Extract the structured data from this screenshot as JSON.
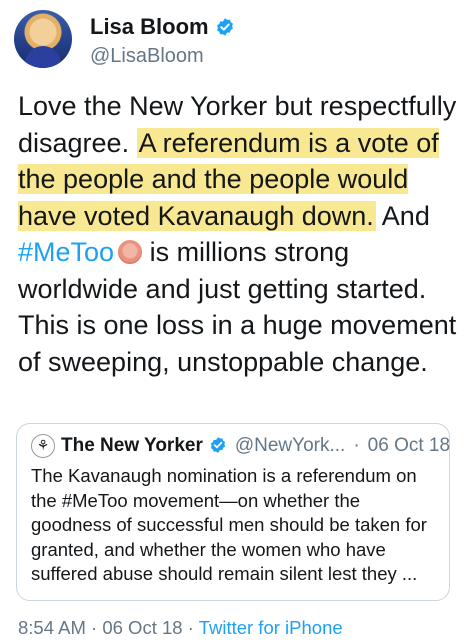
{
  "author": {
    "name": "Lisa Bloom",
    "handle": "@LisaBloom",
    "verified_icon": "verified-badge-icon",
    "accent": "#1da1f2"
  },
  "tweet": {
    "text_1": "Love the New Yorker but respectfully disagree. ",
    "highlight": "A referendum is a vote of the people and the people would have voted Kavanaugh down.",
    "text_2": " And ",
    "hashtag": "#MeToo",
    "emoji_icon": "raised-hands-icon",
    "text_3": " is millions strong worldwide and just getting started. This is one loss in a huge movement of sweeping, unstoppable change.",
    "highlight_color": "#f7e06e"
  },
  "quoted": {
    "name": "The New Yorker",
    "handle": "@NewYork...",
    "separator": "·",
    "date": "06 Oct 18",
    "text": "The Kavanaugh nomination is a referendum on the #MeToo movement—on whether the goodness of successful men should be taken for granted, and whether the women who have suffered abuse should remain silent lest they ..."
  },
  "meta": {
    "time": "8:54 AM",
    "sep1": "·",
    "date": "06 Oct 18",
    "sep2": "·",
    "source": "Twitter for iPhone"
  }
}
